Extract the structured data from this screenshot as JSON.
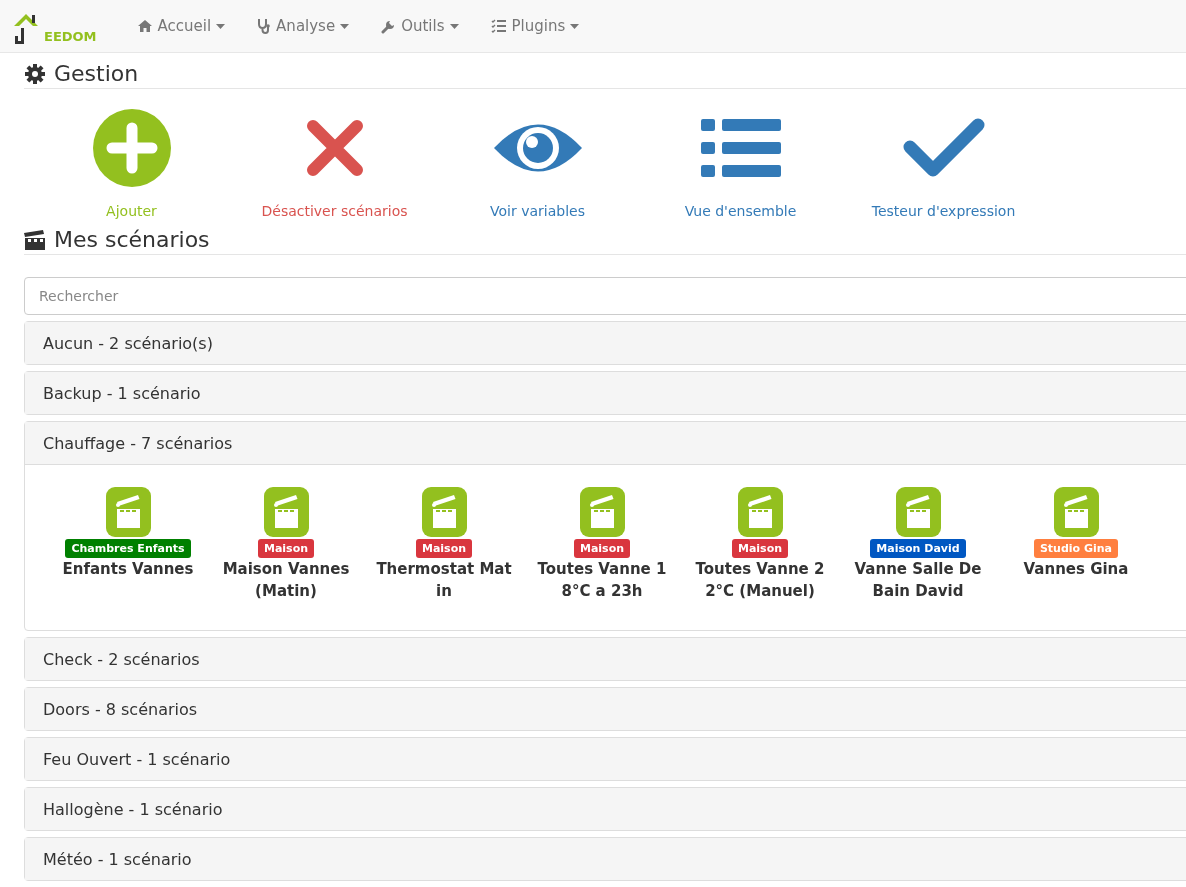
{
  "navbar": {
    "logo_text": "EEDOM",
    "menus": [
      {
        "label": "Accueil",
        "kind": "home"
      },
      {
        "label": "Analyse",
        "kind": "analysis"
      },
      {
        "label": "Outils",
        "kind": "tools"
      },
      {
        "label": "Plugins",
        "kind": "plugins"
      }
    ]
  },
  "management": {
    "title": "Gestion",
    "actions": [
      {
        "label": "Ajouter",
        "kind": "add"
      },
      {
        "label": "Désactiver scénarios",
        "kind": "disable"
      },
      {
        "label": "Voir variables",
        "kind": "variables"
      },
      {
        "label": "Vue d'ensemble",
        "kind": "overview"
      },
      {
        "label": "Testeur d'expression",
        "kind": "tester"
      }
    ]
  },
  "scenarios": {
    "title": "Mes scénarios",
    "search": {
      "placeholder": "Rechercher"
    },
    "groups": [
      {
        "title": "Aucun - 2 scénario(s)",
        "expanded": false
      },
      {
        "title": "Backup - 1 scénario",
        "expanded": false
      },
      {
        "title": "Chauffage - 7 scénarios",
        "expanded": true,
        "items": [
          {
            "tag": "Chambres Enfants",
            "color": "#008000",
            "name": "Enfants Vannes"
          },
          {
            "tag": "Maison",
            "color": "#d9363e",
            "name": "Maison Vannes (Matin)"
          },
          {
            "tag": "Maison",
            "color": "#d9363e",
            "name": "Thermostat Matin"
          },
          {
            "tag": "Maison",
            "color": "#d9363e",
            "name": "Toutes Vanne 18°C a 23h"
          },
          {
            "tag": "Maison",
            "color": "#d9363e",
            "name": "Toutes Vanne 22°C (Manuel)"
          },
          {
            "tag": "Maison David",
            "color": "#0057c2",
            "name": "Vanne Salle De Bain David"
          },
          {
            "tag": "Studio Gina",
            "color": "#ff7f3f",
            "name": "Vannes Gina"
          }
        ]
      },
      {
        "title": "Check - 2 scénarios",
        "expanded": false
      },
      {
        "title": "Doors - 8 scénarios",
        "expanded": false
      },
      {
        "title": "Feu Ouvert - 1 scénario",
        "expanded": false
      },
      {
        "title": "Hallogène - 1 scénario",
        "expanded": false
      },
      {
        "title": "Météo - 1 scénario",
        "expanded": false
      }
    ]
  }
}
